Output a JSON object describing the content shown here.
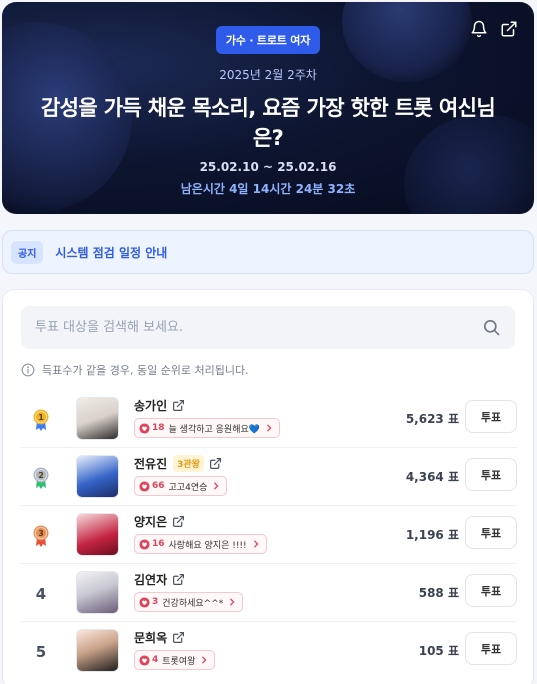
{
  "hero": {
    "category": "가수 · 트로트 여자",
    "week": "2025년 2월 2주차",
    "title": "감성을 가득 채운 목소리, 요즘 가장 핫한 트롯 여신님은?",
    "date_range": "25.02.10 ~ 25.02.16",
    "remaining": "남은시간 4일 14시간 24분 32초",
    "icons": [
      "bell-icon",
      "share-icon"
    ]
  },
  "notice": {
    "badge": "공지",
    "text": "시스템 점검 일정 안내"
  },
  "search": {
    "placeholder": "투표 대상을 검색해 보세요."
  },
  "info_text": "득표수가 같을 경우, 동일 순위로 처리됩니다.",
  "candidates": [
    {
      "rank": "1",
      "medal": "gold",
      "name": "송가인",
      "badge": "",
      "cheer_count": "18",
      "cheer_text": "늘 생각하고 응원해요💙",
      "votes": "5,623 표",
      "vote_label": "투표"
    },
    {
      "rank": "2",
      "medal": "silver",
      "name": "전유진",
      "badge": "3관왕",
      "cheer_count": "66",
      "cheer_text": "고고4연승",
      "votes": "4,364 표",
      "vote_label": "투표"
    },
    {
      "rank": "3",
      "medal": "bronze",
      "name": "양지은",
      "badge": "",
      "cheer_count": "16",
      "cheer_text": "사랑해요 양지은 !!!!",
      "votes": "1,196 표",
      "vote_label": "투표"
    },
    {
      "rank": "4",
      "medal": "",
      "name": "김연자",
      "badge": "",
      "cheer_count": "3",
      "cheer_text": "건강하세요^^*",
      "votes": "588 표",
      "vote_label": "투표"
    },
    {
      "rank": "5",
      "medal": "",
      "name": "문희옥",
      "badge": "",
      "cheer_count": "4",
      "cheer_text": "트롯여왕",
      "votes": "105 표",
      "vote_label": "투표"
    }
  ],
  "colors": {
    "accent": "#2f5bea",
    "heart": "#e0435a",
    "gold": "#f2b423",
    "silver": "#aeb6c4",
    "bronze": "#e8905a"
  }
}
